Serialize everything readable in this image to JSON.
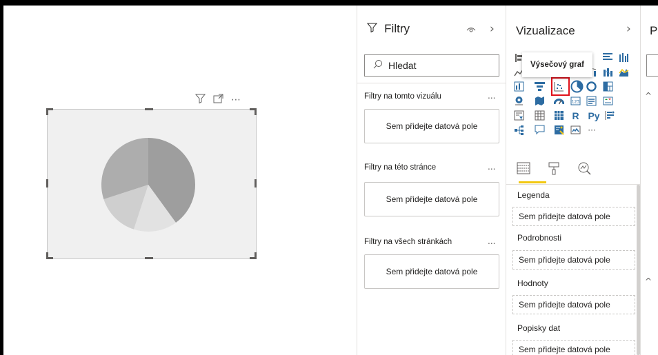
{
  "visual": {
    "header_icons": [
      "filter-icon",
      "focus-mode-icon",
      "more-options-icon"
    ],
    "more_options": "⋯",
    "chart_data": {
      "type": "pie",
      "values": [
        40,
        15,
        15,
        30
      ],
      "colors": [
        "#9e9e9e",
        "#e2e2e2",
        "#cfcfcf",
        "#adadad"
      ],
      "title": ""
    }
  },
  "filters": {
    "title": "Filtry",
    "search_placeholder": "Hledat",
    "sections": [
      {
        "label": "Filtry na tomto vizuálu",
        "more": "...",
        "drop": "Sem přidejte datová pole"
      },
      {
        "label": "Filtry na této stránce",
        "more": "...",
        "drop": "Sem přidejte datová pole"
      },
      {
        "label": "Filtry na všech stránkách",
        "more": "...",
        "drop": "Sem přidejte datová pole"
      }
    ]
  },
  "visualizations": {
    "title": "Vizualizace",
    "tooltip": "Výsečový graf",
    "r_label": "R",
    "py_label": "Py",
    "more_visuals": "···",
    "accent": "#f2c811",
    "highlight_color": "#e0101a",
    "wells": [
      {
        "label": "Legenda",
        "drop": "Sem přidejte datová pole"
      },
      {
        "label": "Podrobnosti",
        "drop": "Sem přidejte datová pole"
      },
      {
        "label": "Hodnoty",
        "drop": "Sem přidejte datová pole"
      },
      {
        "label": "Popisky dat",
        "drop": "Sem přidejte datová pole"
      }
    ]
  },
  "format": {
    "title": "Po"
  }
}
